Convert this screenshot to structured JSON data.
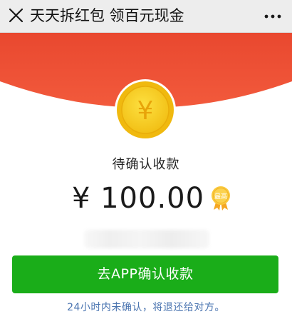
{
  "navbar": {
    "title": "天天拆红包 领百元现金"
  },
  "coin": {
    "symbol": "¥"
  },
  "redpacket": {
    "status": "待确认收款",
    "amount": "¥ 100.00",
    "badge": "最高"
  },
  "actions": {
    "confirm_label": "去APP确认收款"
  },
  "footer": {
    "notice": "24小时内未确认，将退还给对方。"
  },
  "colors": {
    "banner": "#f0563a",
    "button": "#1aad19",
    "coin": "#f7cc1b",
    "notice": "#4a74b0"
  }
}
